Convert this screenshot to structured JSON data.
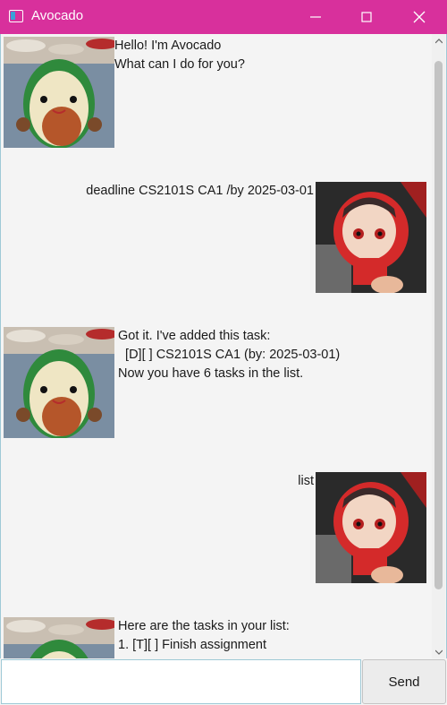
{
  "window": {
    "title": "Avocado"
  },
  "messages": [
    {
      "sender": "avocado",
      "avatar": "avocado-crochet-avatar",
      "lines": [
        "Hello! I'm Avocado",
        "What can I do for you?"
      ]
    },
    {
      "sender": "user",
      "avatar": "red-hooded-plush-avatar",
      "lines": [
        "deadline CS2101S CA1 /by 2025-03-01"
      ]
    },
    {
      "sender": "avocado",
      "avatar": "avocado-crochet-avatar",
      "lines": [
        "Got it. I've added this task:",
        "  [D][ ] CS2101S CA1 (by: 2025-03-01)",
        "Now you have 6 tasks in the list."
      ]
    },
    {
      "sender": "user",
      "avatar": "red-hooded-plush-avatar",
      "lines": [
        "list"
      ]
    },
    {
      "sender": "avocado",
      "avatar": "avocado-crochet-avatar",
      "lines": [
        "Here are the tasks in your list:",
        "1. [T][ ] Finish assignment"
      ]
    }
  ],
  "input": {
    "value": "",
    "placeholder": ""
  },
  "send_button": {
    "label": "Send"
  },
  "colors": {
    "titlebar": "#d8309c",
    "background": "#f4f4f4",
    "input_border": "#9ec9d6"
  }
}
